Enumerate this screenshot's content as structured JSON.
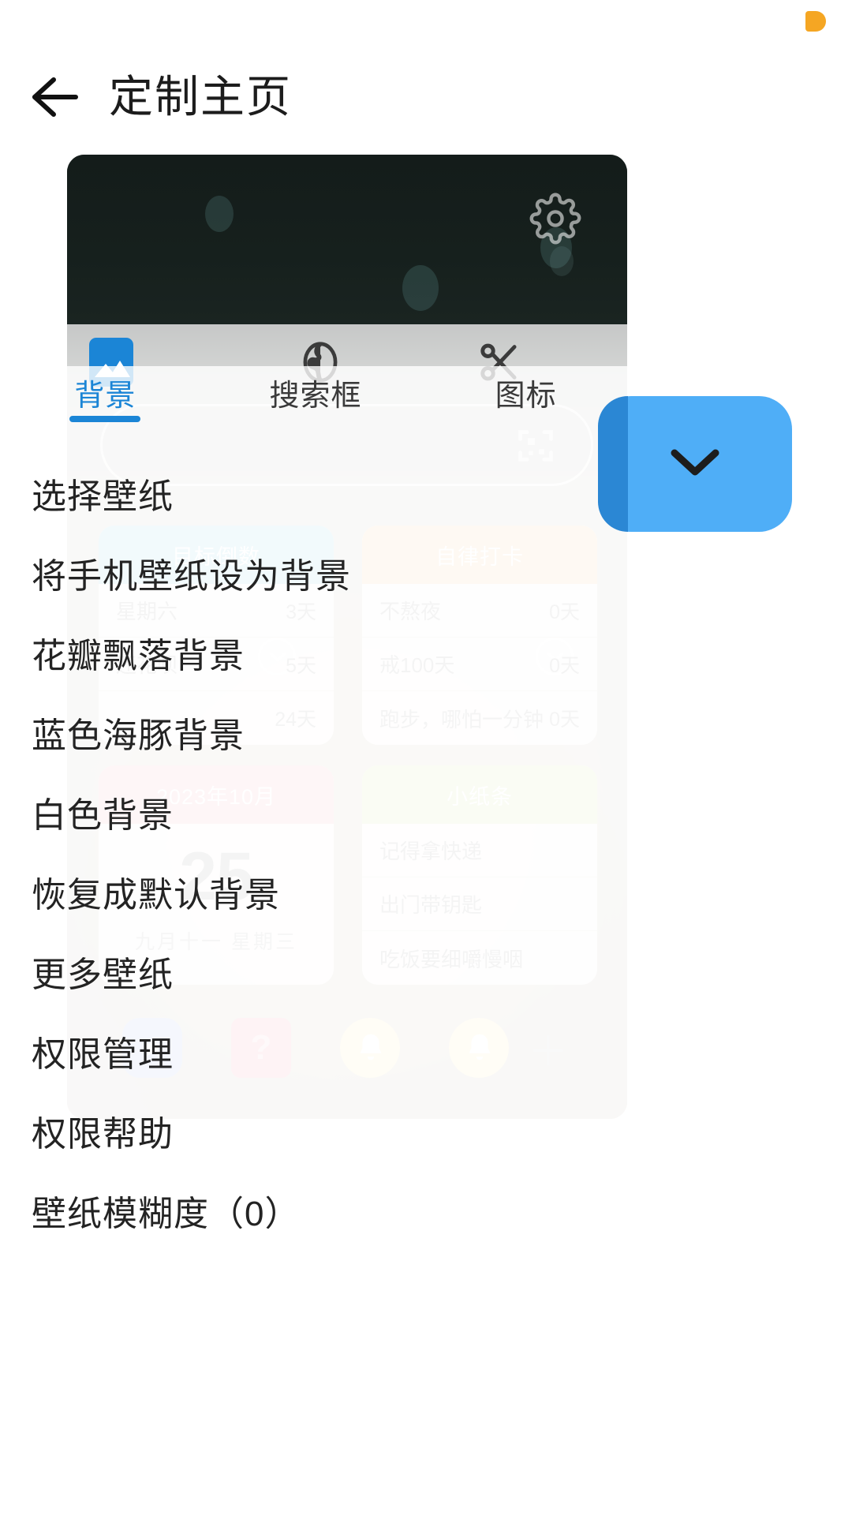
{
  "statusbar": {
    "notch_color": "#F5A623"
  },
  "header": {
    "back_icon": "arrow-left-icon",
    "title": "定制主页"
  },
  "preview": {
    "gear_icon": "gear-icon",
    "qr_icon": "qr-scan-icon",
    "app_icons": [
      "picture-icon",
      "globe-icon",
      "scissors-icon"
    ],
    "widgets": [
      {
        "title": "自律打卡",
        "header_color": "#fbdfc0",
        "rows": [
          {
            "label": "不熬夜",
            "value": "0天"
          },
          {
            "label": "戒100天",
            "value": "0天"
          },
          {
            "label": "跑步，哪怕一分钟",
            "value": "0天"
          }
        ]
      },
      {
        "title": "小纸条",
        "header_color": "#e3efc6",
        "notes": [
          "记得拿快递",
          "出门带钥匙",
          "吃饭要细嚼慢咽"
        ]
      },
      {
        "title": "目标倒数",
        "header_color": "#bfe3ef",
        "rows": [
          {
            "label": "星期六",
            "value": "3天"
          },
          {
            "label": "还花呗",
            "value": "5天"
          },
          {
            "label": "",
            "value": "24天"
          }
        ]
      },
      {
        "title": "2023年10月",
        "header_color": "#f8d2d6",
        "day": "25",
        "lunar": "九月十一  星期三"
      }
    ],
    "dock": {
      "icons": [
        "star-badge-icon",
        "question-note-icon",
        "bell-icon",
        "bell-icon"
      ],
      "add_label": "＋"
    },
    "mini_chevrons": [
      "chevron-down-icon",
      "chevron-down-icon"
    ]
  },
  "drawer": {
    "tabs": [
      {
        "label": "背景",
        "active": true
      },
      {
        "label": "搜索框",
        "active": false
      },
      {
        "label": "图标",
        "active": false
      }
    ],
    "accent_color": "#1b85d6",
    "menu": [
      {
        "label": "选择壁纸"
      },
      {
        "label": "将手机壁纸设为背景"
      },
      {
        "label": "花瓣飘落背景"
      },
      {
        "label": "蓝色海豚背景"
      },
      {
        "label": "白色背景"
      },
      {
        "label": "恢复成默认背景"
      },
      {
        "label": "更多壁纸"
      },
      {
        "label": "权限管理"
      },
      {
        "label": "权限帮助"
      },
      {
        "label": "壁纸模糊度（0）"
      }
    ]
  },
  "fab": {
    "icon": "chevron-down-icon",
    "color": "#4FAEF7"
  }
}
